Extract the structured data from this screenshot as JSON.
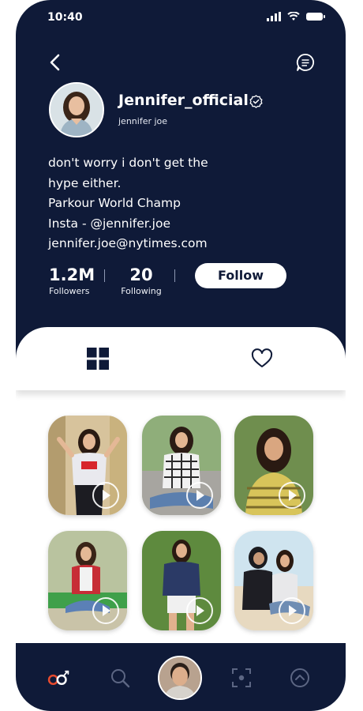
{
  "status_bar": {
    "time": "10:40"
  },
  "profile": {
    "username": "Jennifer_official",
    "real_name": "jennifer joe",
    "bio_lines": [
      "don't worry i don't get the",
      "hype either.",
      "Parkour World Champ",
      "Insta - @jennifer.joe",
      "jennifer.joe@nytimes.com"
    ]
  },
  "stats": {
    "followers": {
      "value": "1.2M",
      "label": "Followers"
    },
    "following": {
      "value": "20",
      "label": "Following"
    }
  },
  "actions": {
    "follow_label": "Follow"
  },
  "tabs": [
    {
      "icon": "grid-icon",
      "active": true
    },
    {
      "icon": "heart-icon",
      "active": false
    }
  ],
  "posts": [
    {
      "type": "video",
      "icon": "play-icon"
    },
    {
      "type": "video",
      "icon": "play-icon"
    },
    {
      "type": "video",
      "icon": "play-icon"
    },
    {
      "type": "video",
      "icon": "play-icon"
    },
    {
      "type": "video",
      "icon": "play-icon"
    },
    {
      "type": "video",
      "icon": "play-icon"
    }
  ],
  "bottom_nav": [
    {
      "icon": "home-logo-icon",
      "active": true
    },
    {
      "icon": "search-icon",
      "active": false
    },
    {
      "icon": "profile-avatar",
      "active": false
    },
    {
      "icon": "focus-frame-icon",
      "active": false
    },
    {
      "icon": "chevron-up-circle-icon",
      "active": false
    }
  ],
  "colors": {
    "primary_dark": "#0f1a38",
    "accent": "#e94b2e",
    "white": "#ffffff"
  }
}
